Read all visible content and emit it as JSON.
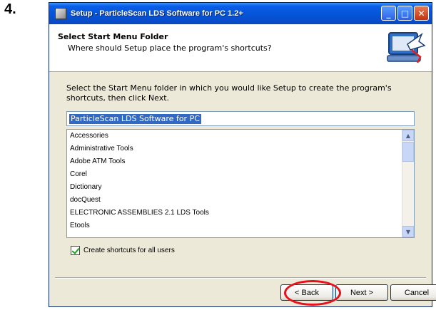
{
  "step_label": "4.",
  "window": {
    "title": "Setup - ParticleScan LDS Software for PC 1.2+",
    "controls": {
      "minimize": "_",
      "maximize": "□",
      "close": "✕"
    }
  },
  "header": {
    "title": "Select Start Menu Folder",
    "subtitle": "Where should Setup place the program's shortcuts?",
    "icon": "computer-shortcut-icon"
  },
  "instructions": "Select the Start Menu folder in which you would like Setup to create the program's shortcuts, then click Next.",
  "folder_input": {
    "value": "ParticleScan LDS Software for PC"
  },
  "folder_list": {
    "items": [
      "Accessories",
      "Administrative Tools",
      "Adobe ATM Tools",
      "Corel",
      "Dictionary",
      "docQuest",
      "ELECTRONIC ASSEMBLIES 2.1 LDS Tools",
      "Etools"
    ]
  },
  "checkbox": {
    "label": "Create shortcuts for all users",
    "checked": true
  },
  "buttons": {
    "back": "< Back",
    "next": "Next >",
    "cancel": "Cancel"
  },
  "highlight_color": "#e8101a"
}
